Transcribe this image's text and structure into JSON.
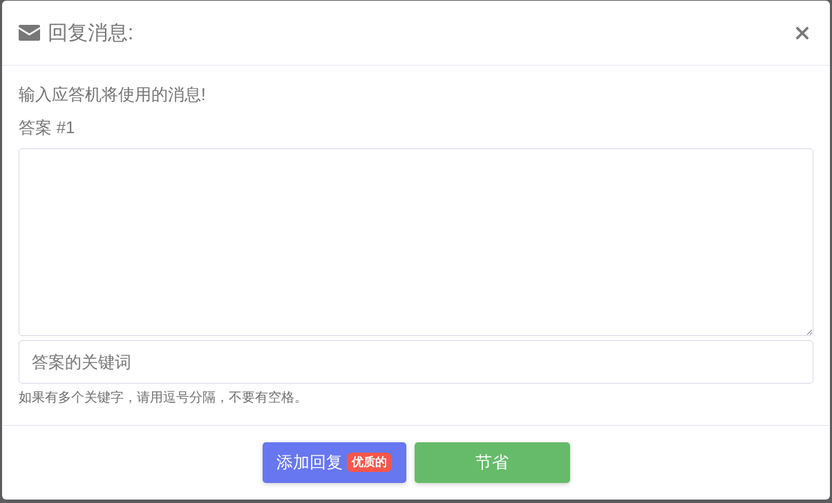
{
  "dialog": {
    "title": "回复消息:",
    "intro": "输入应答机将使用的消息!",
    "answers": [
      {
        "label": "答案 #1",
        "keywords": {
          "placeholder": "答案的关键词"
        },
        "hint": "如果有多个关键字，请用逗号分隔，不要有空格。"
      }
    ],
    "buttons": [
      {
        "kind": "add",
        "label": "添加回复",
        "badge": "优质的"
      },
      {
        "kind": "save",
        "label": "节省"
      }
    ]
  }
}
